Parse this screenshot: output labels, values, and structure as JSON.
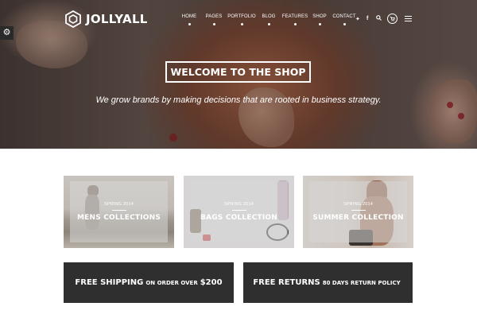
{
  "header": {
    "logo_text": "JOLLYALL",
    "nav": [
      "HOME",
      "PAGES",
      "PORTFOLIO",
      "BLOG",
      "FEATURES",
      "SHOP",
      "CONTACT"
    ],
    "icons": [
      "twitter-icon",
      "facebook-icon",
      "search-icon",
      "cart-icon",
      "menu-icon"
    ]
  },
  "hero": {
    "title": "WELCOME TO THE SHOP",
    "subtitle": "We grow brands by making decisions that are rooted in business strategy."
  },
  "collections": [
    {
      "season": "SPRING 2014",
      "title": "MENS COLLECTIONS"
    },
    {
      "season": "SPRING 2014",
      "title": "BAGS COLLECTION"
    },
    {
      "season": "SPRING 2014",
      "title": "SUMMER COLLECTION"
    }
  ],
  "promos": [
    {
      "big1": "FREE SHIPPING",
      "small": "ON ORDER OVER",
      "big2": "$200"
    },
    {
      "big1": "FREE RETURNS",
      "small": "80 DAYS RETURN POLICY",
      "big2": ""
    }
  ],
  "colors": {
    "promo_bg": "#2f2f2f",
    "text_light": "#ffffff"
  }
}
